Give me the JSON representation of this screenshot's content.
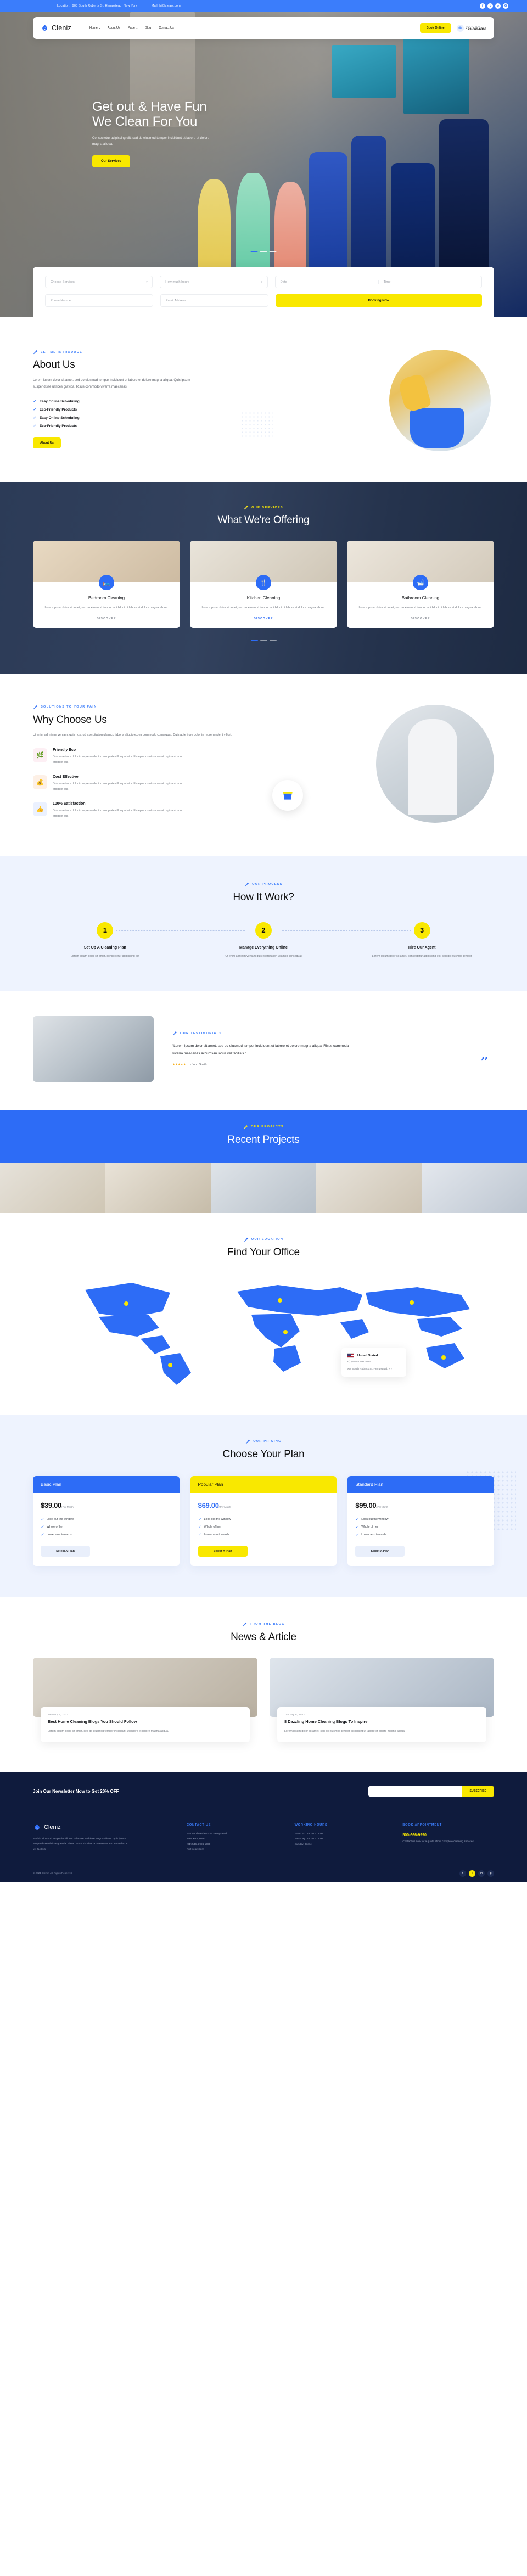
{
  "topbar": {
    "location_label": "Location:",
    "location_value": "908 South Roberts St, Hempstead, New York",
    "mail_label": "Mail:",
    "mail_value": "hi@cleary.com",
    "socials": [
      "f",
      "t",
      "p",
      "G"
    ]
  },
  "nav": {
    "brand": "Cleniz",
    "items": [
      {
        "label": "Home",
        "caret": "▾"
      },
      {
        "label": "About Us",
        "caret": ""
      },
      {
        "label": "Page",
        "caret": "▾"
      },
      {
        "label": "Blog",
        "caret": ""
      },
      {
        "label": "Contact Us",
        "caret": ""
      }
    ],
    "book_button": "Book Online",
    "chat_label": "LET'S CHAT",
    "chat_phone": "123-666-6868"
  },
  "hero": {
    "title_line1": "Get out & Have Fun",
    "title_line2": "We Clean For You",
    "paragraph": "Consectetur adipiscing elit, sed do eiusmod tempor incididunt ut labore et dolore magna aliqua.",
    "cta": "Our Services"
  },
  "booking": {
    "service_placeholder": "Choose Services",
    "hours_placeholder": "How much hours",
    "date_placeholder": "Date",
    "time_placeholder": "Time",
    "phone_placeholder": "Phone Number",
    "email_placeholder": "Email Address",
    "submit": "Booking Now"
  },
  "about": {
    "eyebrow": "LET ME INTRODUCE",
    "title": "About Us",
    "paragraph": "Lorem ipsum dolor sit amet, sed do eiusmod tempor incididunt ut labore et dolore magna aliqua. Quis ipsum suspendisse ultrices gravida. Risus commodo viverra maecenas",
    "checklist": [
      "Easy Online Scheduling",
      "Eco-Friendly Products",
      "Easy Online Scheduling",
      "Eco-Friendly Products"
    ],
    "cta": "About Us"
  },
  "services": {
    "eyebrow": "OUR SERVICES",
    "title": "What We're Offering",
    "cards": [
      {
        "title": "Bedroom Cleaning",
        "desc": "Lorem ipsum dolor sit amet, sed do eiusmod tempor incididunt ut labore et dolore magna aliqua.",
        "link": "DISCOVER",
        "icon": "🛏"
      },
      {
        "title": "Kitchen Cleaning",
        "desc": "Lorem ipsum dolor sit amet, sed do eiusmod tempor incididunt ut labore et dolore magna aliqua.",
        "link": "DISCOVER",
        "icon": "🍴"
      },
      {
        "title": "Bathroom Cleaning",
        "desc": "Lorem ipsum dolor sit amet, sed do eiusmod tempor incididunt ut labore et dolore magna aliqua.",
        "link": "DISCOVER",
        "icon": "🛁"
      }
    ]
  },
  "why": {
    "eyebrow": "SOLUTIONS TO YOUR PAIN",
    "title": "Why Choose Us",
    "paragraph": "Ut enim ad minim veniam, quis nostrud exercitation ullamco laboris aliquip ex ea commodo consequat. Duis aute irure dolor in reprehenderit villort.",
    "features": [
      {
        "title": "Friendly Eco",
        "desc": "Duis aute irure dolor in reprehenderit in voluptate cillun pariatur. Excepteur sint occaecat cupidatat non proident qui.",
        "icon": "🌿"
      },
      {
        "title": "Cost Effective",
        "desc": "Duis aute irure dolor in reprehenderit in voluptate cillun pariatur. Excepteur sint occaecat cupidatat non proident qui.",
        "icon": "💰"
      },
      {
        "title": "100% Satisfaction",
        "desc": "Duis aute irure dolor in reprehenderit in voluptate cillun pariatur. Excepteur sint occaecat cupidatat non proident qui.",
        "icon": "👍"
      }
    ]
  },
  "how": {
    "eyebrow": "OUR PROCESS",
    "title": "How It Work?",
    "steps": [
      {
        "num": "1",
        "title": "Set Up A Cleaning Plan",
        "desc": "Lorem ipsum dolor sit amet, consectetur adipiscing elit"
      },
      {
        "num": "2",
        "title": "Manage Everything Online",
        "desc": "Ut enim a minim veniam quis exercitation ullamco consequat"
      },
      {
        "num": "3",
        "title": "Hire Our Agent",
        "desc": "Lorem ipsum dolor sit amet, consectetur adipiscing elit, sed do eiusmod tempor"
      }
    ]
  },
  "testimonial": {
    "eyebrow": "OUR TESTIMONIALS",
    "quote": "“Lorem ipsum dolor sit amet, sed do eiusmod tempor incididunt ut labore et dolore magna aliqua. Risus commoda viverra maecenas accumsan lacus vel facilisis.”",
    "stars": "★★★★★",
    "author": "- John Smith",
    "mark": "”"
  },
  "projects": {
    "eyebrow": "OUR PROJECTS",
    "title": "Recent Projects"
  },
  "location": {
    "eyebrow": "OUR LOCATION",
    "title": "Find Your Office",
    "card_country": "United Stated",
    "card_phone": "+(1) 546 8 996 1020",
    "card_address": "908 South Roberts St, Hempstead, NY"
  },
  "pricing": {
    "eyebrow": "OUR PRICING",
    "title": "Choose Your Plan",
    "plans": [
      {
        "name": "Basic Plan",
        "price": "$39.00",
        "per": "/ Per Month",
        "accent": "#2d6cf6",
        "featured": false,
        "features": [
          "Look out the window",
          "Whole of her",
          "Lower arm towards"
        ],
        "button": "Select A Plan"
      },
      {
        "name": "Popular Plan",
        "price": "$69.00",
        "per": "/ Per Month",
        "accent": "#f9e800",
        "featured": true,
        "features": [
          "Look out the window",
          "Whole of her",
          "Lower arm towards"
        ],
        "button": "Select A Plan"
      },
      {
        "name": "Standard Plan",
        "price": "$99.00",
        "per": "/ Per Month",
        "accent": "#2d6cf6",
        "featured": false,
        "features": [
          "Look out the window",
          "Whole of her",
          "Lower arm towards"
        ],
        "button": "Select A Plan"
      }
    ]
  },
  "blog": {
    "eyebrow": "FROM THE BLOG",
    "title": "News & Article",
    "posts": [
      {
        "meta": "January 6, 2021",
        "title": "Best Home Cleaning Blogs You Should Follow",
        "desc": "Lorem ipsum dolor sit amet, sed do eiusmod tempor incididunt ut labore et dolore magna aliqua."
      },
      {
        "meta": "January 6, 2021",
        "title": "8 Dazzling Home Cleaning Blogs To Inspire",
        "desc": "Lorem ipsum dolor sit amet, sed do eiusmod tempor incididunt ut labore et dolore magna aliqua."
      }
    ]
  },
  "newsletter": {
    "title": "Join Our Newsletter Now to Get 20% OFF",
    "input_placeholder": "",
    "button": "SUBSCRIBE"
  },
  "footer": {
    "brand": "Cleniz",
    "about": "Sed do eiusmod tempor incididunt ut labore et dolore magna aliqua. Quis ipsum suspendisse ultrices gravida. Risus commodo viverra maecenas accumsan lacus vel facilisis.",
    "contact_title": "CONTACT US",
    "contact_lines": [
      "908 South Roberts St, Hempstead,",
      "New York, USA",
      "+(1) 546 4 996 1020",
      "hi@cleary.com"
    ],
    "hours_title": "WORKING HOURS",
    "hours_lines": [
      "Mon - Fri : 08:00 - 18:00",
      "Saturday : 09:00 - 16:00",
      "Sunday: Close"
    ],
    "booking_title": "BOOK APPOINTMENT",
    "booking_phone": "500-666-9990",
    "booking_note": "Contact us now for a quote about complete cleaning services",
    "copyright": "© 2021 Cleniz. All Rights Reserved",
    "socials": [
      "f",
      "t",
      "in",
      "p"
    ]
  }
}
